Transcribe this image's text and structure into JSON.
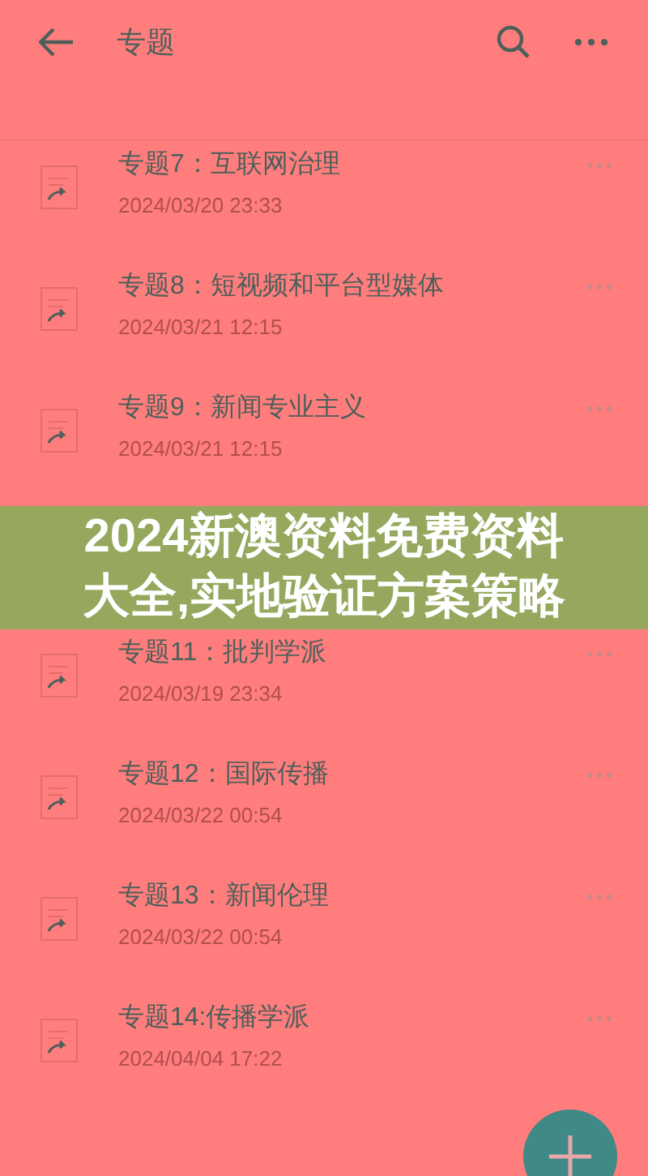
{
  "app_bar": {
    "title": "专题"
  },
  "notes": [
    {
      "title": "专题7：互联网治理",
      "date": "2024/03/20 23:33"
    },
    {
      "title": "专题8：短视频和平台型媒体",
      "date": "2024/03/21 12:15"
    },
    {
      "title": "专题9：新闻专业主义",
      "date": "2024/03/21 12:15"
    },
    {
      "title": "专题11：批判学派",
      "date": "2024/03/19 23:34"
    },
    {
      "title": "专题12：国际传播",
      "date": "2024/03/22 00:54"
    },
    {
      "title": "专题13：新闻伦理",
      "date": "2024/03/22 00:54"
    },
    {
      "title": "专题14:传播学派",
      "date": "2024/04/04 17:22"
    }
  ],
  "overlay_banner": {
    "text": "2024新澳资料免费资料大全,实地验证方案策略"
  }
}
